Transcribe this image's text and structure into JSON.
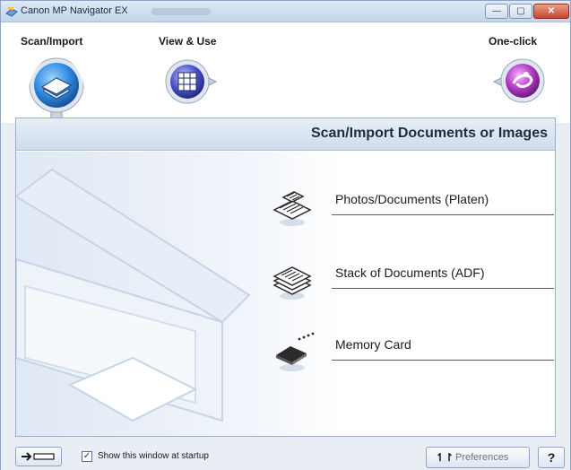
{
  "window": {
    "title": "Canon MP Navigator EX"
  },
  "titlebar": {
    "minimize": "—",
    "maximize": "▢",
    "close": "✕"
  },
  "modes": [
    {
      "label": "Scan/Import",
      "icon": "scanner-icon",
      "selected": true
    },
    {
      "label": "View & Use",
      "icon": "view-grid-icon",
      "selected": false
    },
    {
      "label": "One-click",
      "icon": "one-click-icon",
      "selected": false
    }
  ],
  "panel": {
    "title": "Scan/Import Documents or Images"
  },
  "actions": [
    {
      "label": "Photos/Documents (Platen)",
      "icon": "platen-documents-icon"
    },
    {
      "label": "Stack of Documents (ADF)",
      "icon": "adf-stack-icon"
    },
    {
      "label": "Memory Card",
      "icon": "memory-card-icon"
    }
  ],
  "statusbar": {
    "show_at_startup_label": "Show this window at startup",
    "show_at_startup_checked": true,
    "preferences_label": "Preferences",
    "preferences_icon": "↿↾",
    "help_label": "?"
  },
  "colors": {
    "accent": "#2d5fa6",
    "panel_header": "#cfdcec",
    "window_bg": "#e9eef5"
  }
}
